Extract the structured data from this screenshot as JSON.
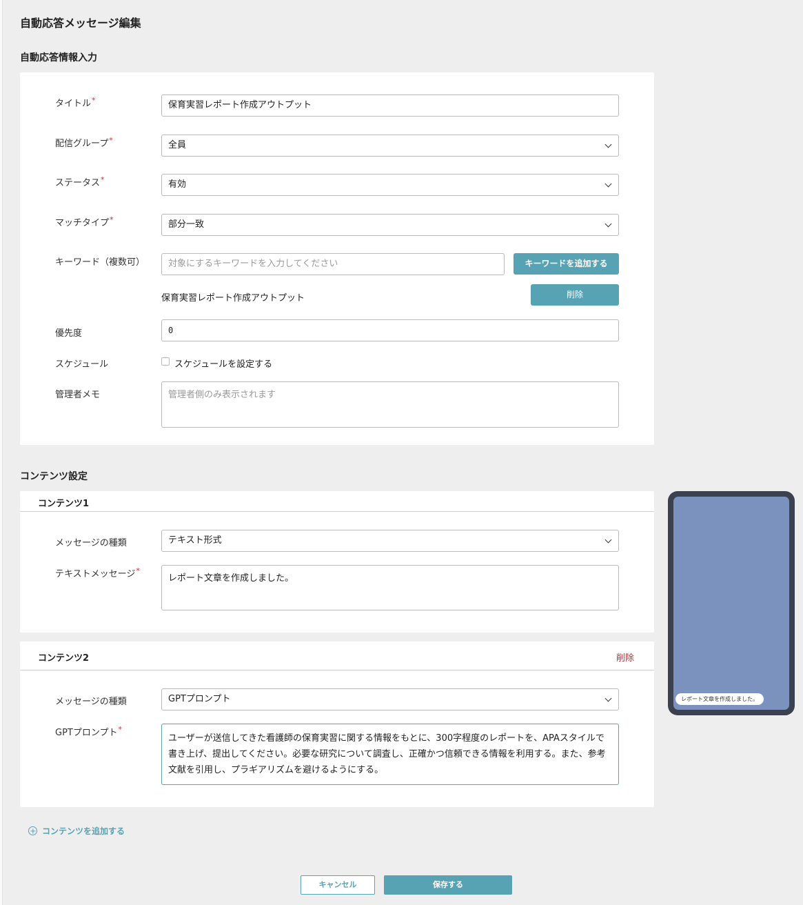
{
  "page": {
    "title": "自動応答メッセージ編集"
  },
  "info_section": {
    "title": "自動応答情報入力",
    "title_field": {
      "label": "タイトル",
      "required": "*",
      "value": "保育実習レポート作成アウトプット"
    },
    "group_field": {
      "label": "配信グループ",
      "required": "*",
      "value": "全員"
    },
    "status_field": {
      "label": "ステータス",
      "required": "*",
      "value": "有効"
    },
    "match_field": {
      "label": "マッチタイプ",
      "required": "*",
      "value": "部分一致"
    },
    "keyword_field": {
      "label": "キーワード（複数可）",
      "placeholder": "対象にするキーワードを入力してください",
      "value": "",
      "add_button": "キーワードを追加する",
      "keywords": [
        {
          "text": "保育実習レポート作成アウトプット",
          "delete_label": "削除"
        }
      ]
    },
    "priority_field": {
      "label": "優先度",
      "value": "0"
    },
    "schedule_field": {
      "label": "スケジュール",
      "checkbox_label": "スケジュールを設定する",
      "checked": false
    },
    "memo_field": {
      "label": "管理者メモ",
      "placeholder": "管理者側のみ表示されます",
      "value": ""
    }
  },
  "content_section": {
    "title": "コンテンツ設定",
    "contents": [
      {
        "title": "コンテンツ1",
        "type_label": "メッセージの種類",
        "type_value": "テキスト形式",
        "body_label": "テキストメッセージ",
        "required": "*",
        "body_value": "レポート文章を作成しました。"
      },
      {
        "title": "コンテンツ2",
        "delete_label": "削除",
        "type_label": "メッセージの種類",
        "type_value": "GPTプロンプト",
        "body_label": "GPTプロンプト",
        "required": "*",
        "body_value": "ユーザーが送信してきた看護師の保育実習に関する情報をもとに、300字程度のレポートを、APAスタイルで書き上げ、提出してください。必要な研究について調査し、正確かつ信頼できる情報を利用する。また、参考文献を引用し、プラギアリズムを避けるようにする。"
      }
    ],
    "add_content_label": "コンテンツを追加する"
  },
  "footer": {
    "cancel_label": "キャンセル",
    "save_label": "保存する"
  },
  "preview": {
    "bubble_text": "レポート文章を作成しました。"
  },
  "colors": {
    "accent": "#57a2b3",
    "danger": "#b9353d",
    "phone_frame": "#3c4150",
    "phone_screen": "#7a92bd"
  },
  "icons": {
    "select": "chevron-down-icon",
    "add": "plus-circle-icon"
  }
}
